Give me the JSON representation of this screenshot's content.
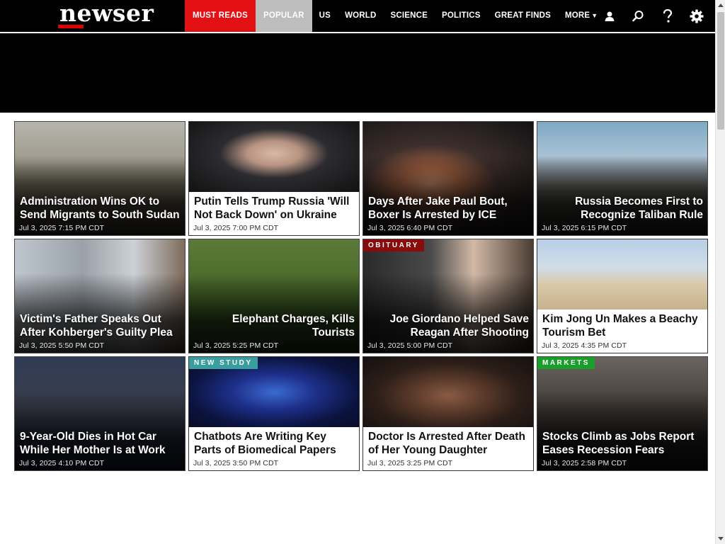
{
  "brand": {
    "name": "newser",
    "accent_color": "#e31014"
  },
  "nav": {
    "items": [
      {
        "label": "MUST READS",
        "style": "must"
      },
      {
        "label": "POPULAR",
        "style": "popular"
      },
      {
        "label": "US",
        "style": ""
      },
      {
        "label": "WORLD",
        "style": ""
      },
      {
        "label": "SCIENCE",
        "style": ""
      },
      {
        "label": "POLITICS",
        "style": ""
      },
      {
        "label": "GREAT FINDS",
        "style": ""
      },
      {
        "label": "MORE",
        "style": ""
      }
    ],
    "icons": [
      "user-icon",
      "search-icon",
      "help-icon",
      "gear-icon"
    ]
  },
  "stories": [
    {
      "headline": "Administration Wins OK to Send Migrants to South Sudan",
      "date": "Jul 3, 2025  7:15 PM CDT",
      "layout": "overlay",
      "align": "left",
      "badge": ""
    },
    {
      "headline": "Putin Tells Trump Russia 'Will Not Back Down' on Ukraine",
      "date": "Jul 3, 2025  7:00 PM CDT",
      "layout": "boxed",
      "align": "left",
      "badge": ""
    },
    {
      "headline": "Days After Jake Paul Bout, Boxer Is Arrested by ICE",
      "date": "Jul 3, 2025  6:40 PM CDT",
      "layout": "overlay",
      "align": "left",
      "badge": ""
    },
    {
      "headline": "Russia Becomes First to Recognize Taliban Rule",
      "date": "Jul 3, 2025  6:15 PM CDT",
      "layout": "overlay",
      "align": "right",
      "badge": ""
    },
    {
      "headline": "Victim's Father Speaks Out After Kohberger's Guilty Plea",
      "date": "Jul 3, 2025  5:50 PM CDT",
      "layout": "overlay",
      "align": "left",
      "badge": ""
    },
    {
      "headline": "Elephant Charges, Kills Tourists",
      "date": "Jul 3, 2025  5:25 PM CDT",
      "layout": "overlay",
      "align": "right",
      "badge": ""
    },
    {
      "headline": "Joe Giordano Helped Save Reagan After Shooting",
      "date": "Jul 3, 2025  5:00 PM CDT",
      "layout": "overlay",
      "align": "right",
      "badge": "OBITUARY",
      "badge_style": "obit"
    },
    {
      "headline": "Kim Jong Un Makes a Beachy Tourism Bet",
      "date": "Jul 3, 2025  4:35 PM CDT",
      "layout": "boxed",
      "align": "left",
      "badge": ""
    },
    {
      "headline": "9-Year-Old Dies in Hot Car While Her Mother Is at Work",
      "date": "Jul 3, 2025  4:10 PM CDT",
      "layout": "overlay",
      "align": "left",
      "badge": ""
    },
    {
      "headline": "Chatbots Are Writing Key Parts of Biomedical Papers",
      "date": "Jul 3, 2025  3:50 PM CDT",
      "layout": "boxed",
      "align": "left",
      "badge": "NEW STUDY",
      "badge_style": "study"
    },
    {
      "headline": "Doctor Is Arrested After Death of Her Young Daughter",
      "date": "Jul 3, 2025  3:25 PM CDT",
      "layout": "boxed",
      "align": "left",
      "badge": ""
    },
    {
      "headline": "Stocks Climb as Jobs Report Eases Recession Fears",
      "date": "Jul 3, 2025  2:58 PM CDT",
      "layout": "overlay",
      "align": "left",
      "badge": "MARKETS",
      "badge_style": "markets"
    }
  ]
}
